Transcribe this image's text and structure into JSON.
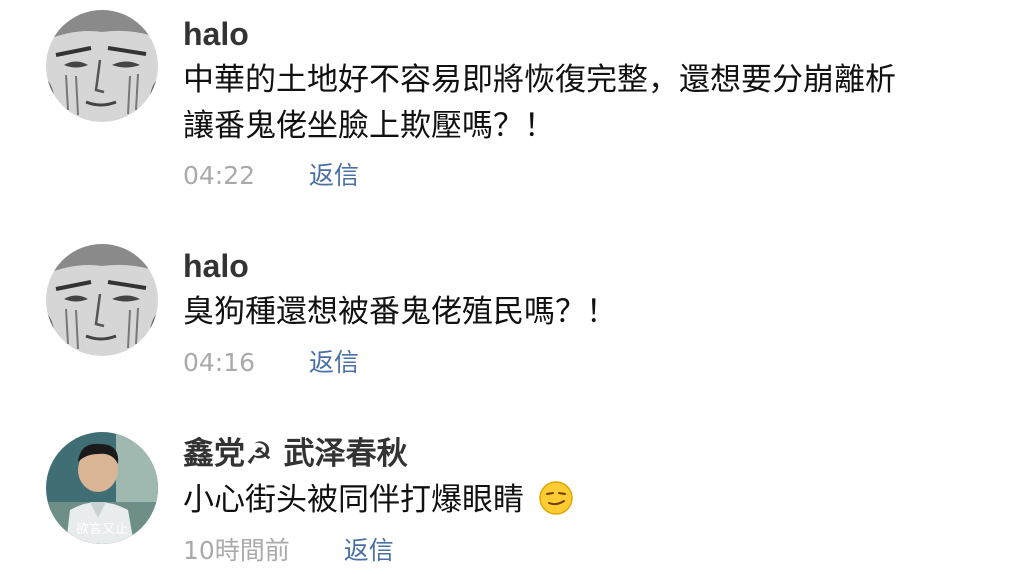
{
  "comments": [
    {
      "username": "halo",
      "lines": [
        "中華的土地好不容易即將恢復完整，還想要分崩離析",
        "讓番鬼佬坐臉上欺壓嗎？！"
      ],
      "time": "04:22",
      "reply_label": "返信",
      "avatar": "manga-face-avatar"
    },
    {
      "username": "halo",
      "lines": [
        "臭狗種還想被番鬼佬殖民嗎？！"
      ],
      "time": "04:16",
      "reply_label": "返信",
      "avatar": "manga-face-avatar"
    },
    {
      "username": "鑫党☭ 武泽春秋",
      "lines": [
        "小心街头被同伴打爆眼睛"
      ],
      "emoji": "smirking-face-emoji",
      "time": "10時間前",
      "reply_label": "返信",
      "avatar": "photo-avatar",
      "avatar_caption": "欲言又止"
    }
  ],
  "colors": {
    "username": "#333333",
    "text": "#111111",
    "time": "#aaaaaa",
    "reply": "#4a6fa5"
  }
}
